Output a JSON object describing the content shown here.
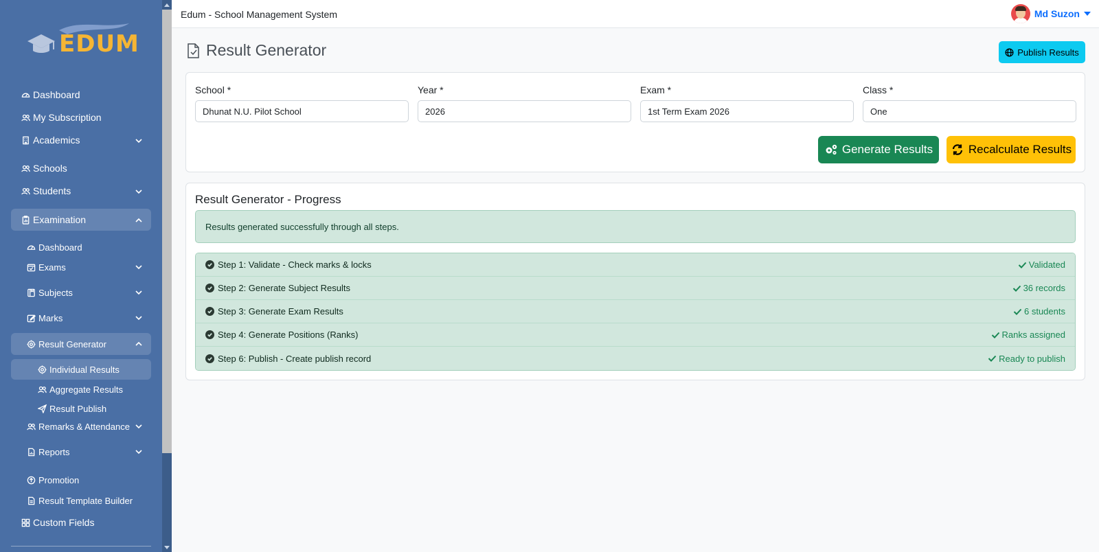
{
  "app": {
    "title": "Edum - School Management System"
  },
  "logo": {
    "text": "EDUM"
  },
  "user": {
    "name": "Md Suzon"
  },
  "sidebar": {
    "items": [
      {
        "label": "Dashboard",
        "icon": "gauge-icon"
      },
      {
        "label": "My Subscription",
        "icon": "users-icon"
      },
      {
        "label": "Academics",
        "icon": "building-icon"
      },
      {
        "label": "Schools",
        "icon": "users-icon"
      },
      {
        "label": "Students",
        "icon": "users-icon"
      },
      {
        "label": "Examination",
        "icon": "clipboard-icon"
      },
      {
        "label": "Dashboard",
        "icon": "gauge-icon"
      },
      {
        "label": "Exams",
        "icon": "calendar-check-icon"
      },
      {
        "label": "Subjects",
        "icon": "book-icon"
      },
      {
        "label": "Marks",
        "icon": "edit-icon"
      },
      {
        "label": "Result Generator",
        "icon": "gear-icon"
      },
      {
        "label": "Individual Results",
        "icon": "gear-icon"
      },
      {
        "label": "Aggregate Results",
        "icon": "users-icon"
      },
      {
        "label": "Result Publish",
        "icon": "send-icon"
      },
      {
        "label": "Remarks & Attendance",
        "icon": "users-icon"
      },
      {
        "label": "Reports",
        "icon": "file-chart-icon"
      },
      {
        "label": "Promotion",
        "icon": "arrow-up-circle-icon"
      },
      {
        "label": "Result Template Builder",
        "icon": "file-icon"
      },
      {
        "label": "Custom Fields",
        "icon": "grid-icon"
      }
    ]
  },
  "page": {
    "title": "Result Generator",
    "publish_button": "Publish Results"
  },
  "filters": {
    "school": {
      "label": "School *",
      "value": "Dhunat N.U. Pilot School"
    },
    "year": {
      "label": "Year *",
      "value": "2026"
    },
    "exam": {
      "label": "Exam *",
      "value": "1st Term Exam 2026"
    },
    "class": {
      "label": "Class *",
      "value": "One"
    }
  },
  "actions": {
    "generate": "Generate Results",
    "recalculate": "Recalculate Results"
  },
  "progress": {
    "title": "Result Generator - Progress",
    "message": "Results generated successfully through all steps.",
    "steps": [
      {
        "label": "Step 1: Validate - Check marks & locks",
        "status": "Validated"
      },
      {
        "label": "Step 2: Generate Subject Results",
        "status": "36 records"
      },
      {
        "label": "Step 3: Generate Exam Results",
        "status": "6 students"
      },
      {
        "label": "Step 4: Generate Positions (Ranks)",
        "status": "Ranks assigned"
      },
      {
        "label": "Step 6: Publish - Create publish record",
        "status": "Ready to publish"
      }
    ]
  },
  "colors": {
    "sidebar": "#4a6fa5",
    "logo": "#f5b534",
    "primary": "#0d6efd",
    "info": "#0dcaf0",
    "success": "#198754",
    "warning": "#ffc107",
    "success_bg": "#d1e7dd"
  }
}
